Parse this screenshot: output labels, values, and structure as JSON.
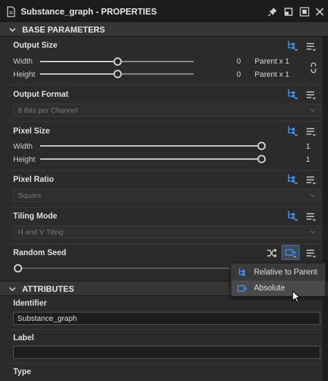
{
  "window": {
    "title": "Substance_graph - PROPERTIES"
  },
  "colors": {
    "accent_blue": "#3a8ee6",
    "panel_bg": "#2b2b2b",
    "titlebar_bg": "#1c1c1c"
  },
  "sections": {
    "base": {
      "label": "BASE PARAMETERS"
    },
    "attributes": {
      "label": "ATTRIBUTES"
    }
  },
  "output_size": {
    "label": "Output Size",
    "width": {
      "label": "Width",
      "value": "0",
      "mode": "Parent x 1",
      "fraction": 0.5
    },
    "height": {
      "label": "Height",
      "value": "0",
      "mode": "Parent x 1",
      "fraction": 0.5
    }
  },
  "output_format": {
    "label": "Output Format",
    "selected": "8 Bits per Channel"
  },
  "pixel_size": {
    "label": "Pixel Size",
    "width": {
      "label": "Width",
      "value": "1",
      "fraction": 1.0
    },
    "height": {
      "label": "Height",
      "value": "1",
      "fraction": 1.0
    }
  },
  "pixel_ratio": {
    "label": "Pixel Ratio",
    "selected": "Square"
  },
  "tiling_mode": {
    "label": "Tiling Mode",
    "selected": "H and V Tiling"
  },
  "random_seed": {
    "label": "Random Seed",
    "fraction": 0.0
  },
  "inheritance_menu": {
    "items": [
      {
        "label": "Relative to Parent",
        "icon": "relative-to-parent-icon"
      },
      {
        "label": "Absolute",
        "icon": "absolute-icon",
        "selected": true
      }
    ]
  },
  "attributes": {
    "identifier": {
      "label": "Identifier",
      "value": "Substance_graph"
    },
    "label": {
      "label": "Label",
      "value": ""
    },
    "type": {
      "label": "Type"
    }
  }
}
